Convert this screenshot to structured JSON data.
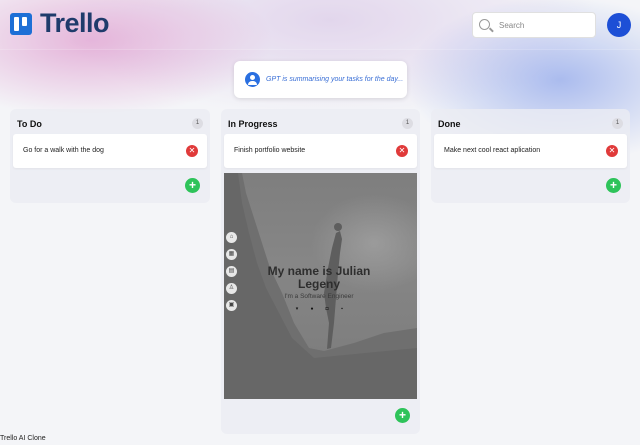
{
  "app": {
    "title": "Trello",
    "footer": "Trello AI Clone"
  },
  "header": {
    "search_placeholder": "Search",
    "avatar_initial": "J"
  },
  "gpt": {
    "message": "GPT is summarising your tasks for the day..."
  },
  "columns": [
    {
      "title": "To Do",
      "count": "1",
      "cards": [
        {
          "text": "Go for a walk with the dog"
        }
      ]
    },
    {
      "title": "In Progress",
      "count": "1",
      "cards": [
        {
          "text": "Finish portfolio website"
        }
      ]
    },
    {
      "title": "Done",
      "count": "1",
      "cards": [
        {
          "text": "Make next cool react aplication"
        }
      ]
    }
  ],
  "portfolio_preview": {
    "name": "My name is Julian Legeny",
    "subtitle": "I'm a Software Engineer",
    "sidebar_icons": [
      "home-icon",
      "grid-icon",
      "document-icon",
      "user-icon",
      "calendar-icon"
    ],
    "social_icons": [
      "twitter-icon",
      "facebook-icon",
      "instagram-icon",
      "linkedin-icon"
    ]
  },
  "colors": {
    "logo_blue": "#1d6fd6",
    "logo_text": "#1f3b6b",
    "avatar": "#1d4fd6",
    "delete_red": "#e03a3a",
    "add_green": "#2ec35a",
    "gpt_text": "#3a6fd6"
  },
  "glyphs": {
    "delete": "✕",
    "add": "+"
  }
}
